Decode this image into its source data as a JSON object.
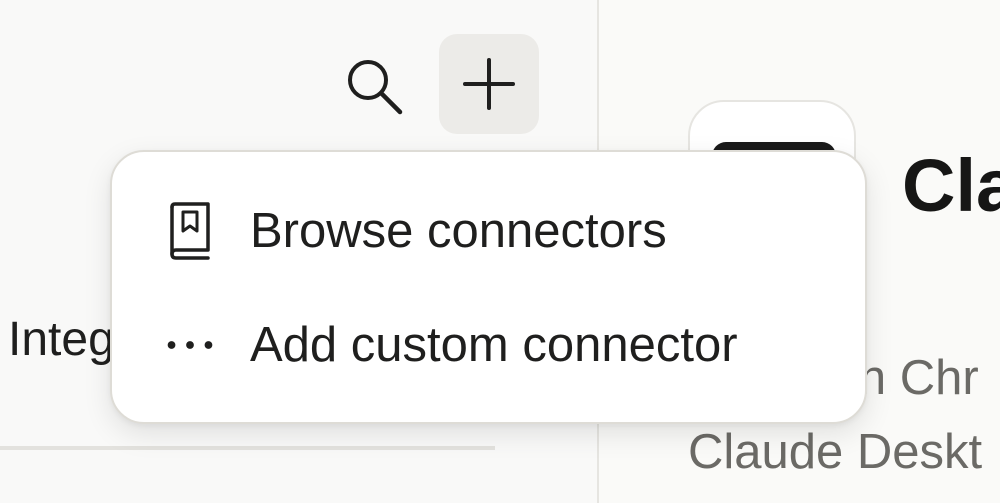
{
  "toolbar": {
    "search_icon": "search-icon",
    "add_icon": "plus-icon"
  },
  "sidebar": {
    "integrations_label": "Integ"
  },
  "menu": {
    "items": [
      {
        "label": "Browse connectors",
        "icon": "book-icon"
      },
      {
        "label": "Add custom connector",
        "icon": "more-horizontal-icon"
      }
    ]
  },
  "detail": {
    "title": "Cla",
    "description_lines": [
      "in Chr",
      "Claude Deskt",
      ""
    ]
  },
  "colors": {
    "background": "#f9f9f8",
    "menu_background": "#ffffff",
    "add_button_background": "#ecebe8",
    "text_primary": "#1f1f1e",
    "text_secondary": "#6b6a66"
  }
}
